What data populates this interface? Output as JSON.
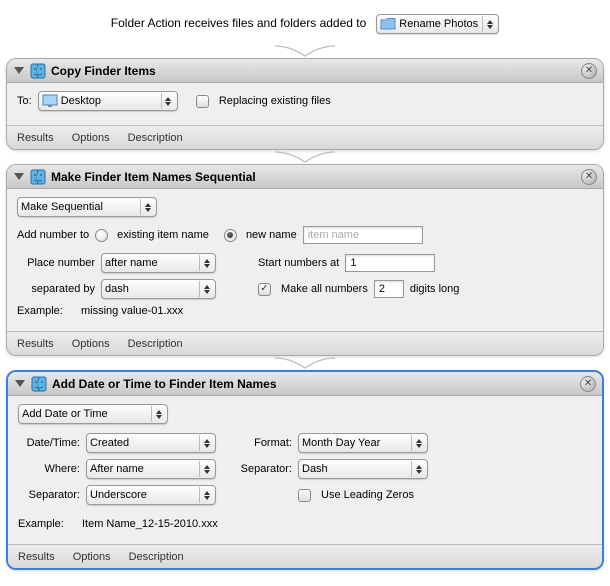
{
  "header": {
    "prefix": "Folder Action receives files and folders added to",
    "folder_name": "Rename Photos"
  },
  "copy": {
    "title": "Copy Finder Items",
    "to_label": "To:",
    "destination": "Desktop",
    "replacing_label": "Replacing existing files"
  },
  "seq": {
    "title": "Make Finder Item Names Sequential",
    "mode": "Make Sequential",
    "add_number_label": "Add number to",
    "radio_existing": "existing item name",
    "radio_new": "new name",
    "item_name_placeholder": "item name",
    "place_label": "Place number",
    "place_value": "after name",
    "start_label": "Start numbers at",
    "start_value": "1",
    "sep_label": "separated by",
    "sep_value": "dash",
    "makeall_label_pre": "Make all numbers",
    "makeall_value": "2",
    "makeall_label_post": "digits long",
    "example_label": "Example:",
    "example_value": "missing value-01.xxx"
  },
  "date": {
    "title": "Add Date or Time to Finder Item Names",
    "mode": "Add Date or Time",
    "datetime_label": "Date/Time:",
    "datetime_value": "Created",
    "format_label": "Format:",
    "format_value": "Month Day Year",
    "where_label": "Where:",
    "where_value": "After name",
    "separator1_label": "Separator:",
    "separator1_value": "Dash",
    "separator2_label": "Separator:",
    "separator2_value": "Underscore",
    "leading_zeros_label": "Use Leading Zeros",
    "example_label": "Example:",
    "example_value": "Item Name_12-15-2010.xxx"
  },
  "footer": {
    "results": "Results",
    "options": "Options",
    "description": "Description"
  }
}
